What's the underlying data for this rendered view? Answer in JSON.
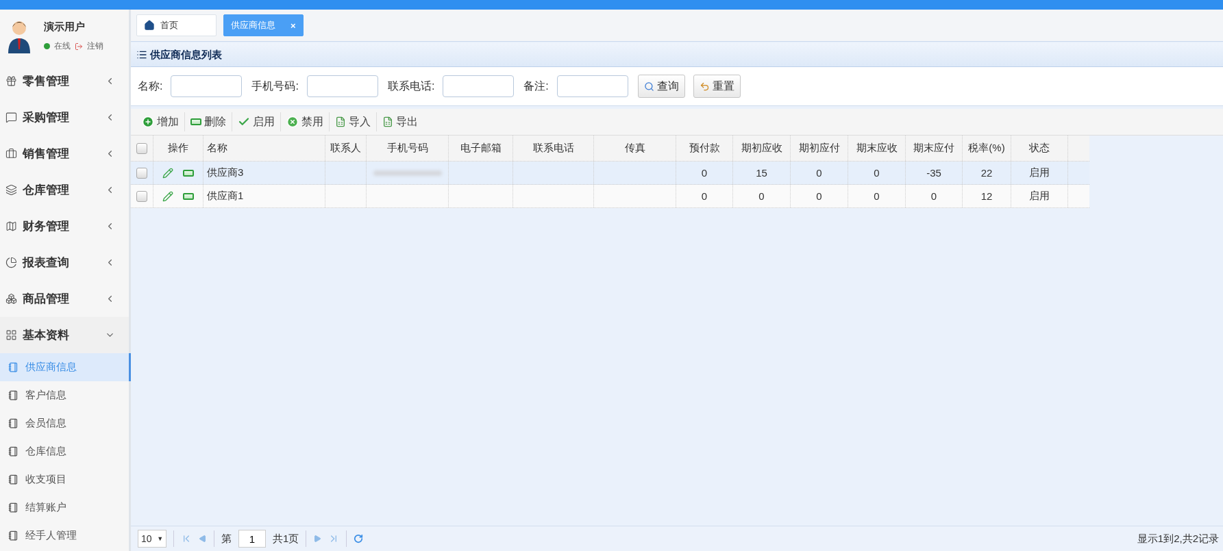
{
  "user": {
    "name": "演示用户",
    "status": "在线",
    "logout": "注销"
  },
  "menu": [
    {
      "label": "零售管理",
      "expanded": false
    },
    {
      "label": "采购管理",
      "expanded": false
    },
    {
      "label": "销售管理",
      "expanded": false
    },
    {
      "label": "仓库管理",
      "expanded": false
    },
    {
      "label": "财务管理",
      "expanded": false
    },
    {
      "label": "报表查询",
      "expanded": false
    },
    {
      "label": "商品管理",
      "expanded": false
    },
    {
      "label": "基本资料",
      "expanded": true,
      "children": [
        {
          "label": "供应商信息",
          "selected": true
        },
        {
          "label": "客户信息",
          "selected": false
        },
        {
          "label": "会员信息",
          "selected": false
        },
        {
          "label": "仓库信息",
          "selected": false
        },
        {
          "label": "收支项目",
          "selected": false
        },
        {
          "label": "结算账户",
          "selected": false
        },
        {
          "label": "经手人管理",
          "selected": false
        }
      ]
    }
  ],
  "tabs": [
    {
      "label": "首页",
      "kind": "home",
      "selected": false
    },
    {
      "label": "供应商信息",
      "kind": "page",
      "close": "×",
      "selected": true
    }
  ],
  "panel_title": "供应商信息列表",
  "search": {
    "fields": [
      {
        "label": "名称:"
      },
      {
        "label": "手机号码:"
      },
      {
        "label": "联系电话:"
      },
      {
        "label": "备注:"
      }
    ],
    "buttons": [
      {
        "label": "查询"
      },
      {
        "label": "重置"
      }
    ]
  },
  "toolbar": [
    {
      "label": "增加"
    },
    {
      "label": "删除"
    },
    {
      "label": "启用"
    },
    {
      "label": "禁用"
    },
    {
      "label": "导入"
    },
    {
      "label": "导出"
    }
  ],
  "table": {
    "header_checked": false,
    "columns": [
      "操作",
      "名称",
      "联系人",
      "手机号码",
      "电子邮箱",
      "联系电话",
      "传真",
      "预付款",
      "期初应收",
      "期初应付",
      "期末应收",
      "期末应付",
      "税率(%)",
      "状态"
    ],
    "rows": [
      {
        "checked": false,
        "selected": true,
        "phone_blurred": true,
        "cells": [
          "",
          "供应商3",
          "",
          "",
          "",
          "",
          "",
          "0",
          "15",
          "0",
          "0",
          "-35",
          "22",
          "启用"
        ]
      },
      {
        "checked": false,
        "selected": false,
        "phone_blurred": false,
        "cells": [
          "",
          "供应商1",
          "",
          "",
          "",
          "",
          "",
          "0",
          "0",
          "0",
          "0",
          "0",
          "12",
          "启用"
        ]
      }
    ]
  },
  "pager": {
    "page_size": "10",
    "caret": "▼",
    "page_prefix": "第",
    "page": "1",
    "total_pages": "共1页",
    "summary": "显示1到2,共2记录"
  }
}
